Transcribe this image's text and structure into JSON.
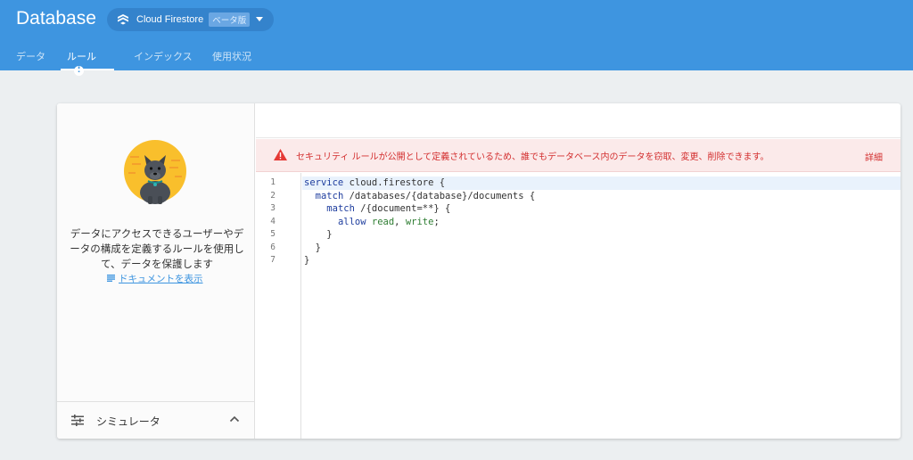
{
  "header": {
    "title": "Database",
    "db_selector": {
      "name": "Cloud Firestore",
      "badge": "ベータ版"
    },
    "tabs": [
      {
        "label": "データ"
      },
      {
        "label": "ルール",
        "alert": "!"
      },
      {
        "label": "インデックス"
      },
      {
        "label": "使用状況"
      }
    ],
    "active_tab": "ルール"
  },
  "left_panel": {
    "description": "データにアクセスできるユーザーやデータの構成を定義するルールを使用して、データを保護します",
    "docs_link": "ドキュメントを表示",
    "simulator_label": "シミュレータ"
  },
  "warning": {
    "message": "セキュリティ ルールが公開として定義されているため、誰でもデータベース内のデータを窃取、変更、削除できます。",
    "details_link": "詳細"
  },
  "editor": {
    "line_numbers": [
      "1",
      "2",
      "3",
      "4",
      "5",
      "6",
      "7"
    ],
    "code": {
      "l1_kw": "service",
      "l1_rest": " cloud.firestore {",
      "l2_indent": "  ",
      "l2_kw": "match",
      "l2_rest": " /databases/{database}/documents {",
      "l3_indent": "    ",
      "l3_kw": "match",
      "l3_rest": " /{document=**} {",
      "l4_indent": "      ",
      "l4_kw": "allow",
      "l4_sp": " ",
      "l4_r": "read",
      "l4_comma": ", ",
      "l4_w": "write",
      "l4_end": ";",
      "l5": "    }",
      "l6": "  }",
      "l7": "}"
    },
    "active_line": 1
  },
  "colors": {
    "header_bg": "#3e95e0",
    "warning_text": "#d32f2f",
    "warning_bg": "#fbeaea",
    "keyword": "#1e3d9e",
    "permission": "#2e7d32"
  }
}
